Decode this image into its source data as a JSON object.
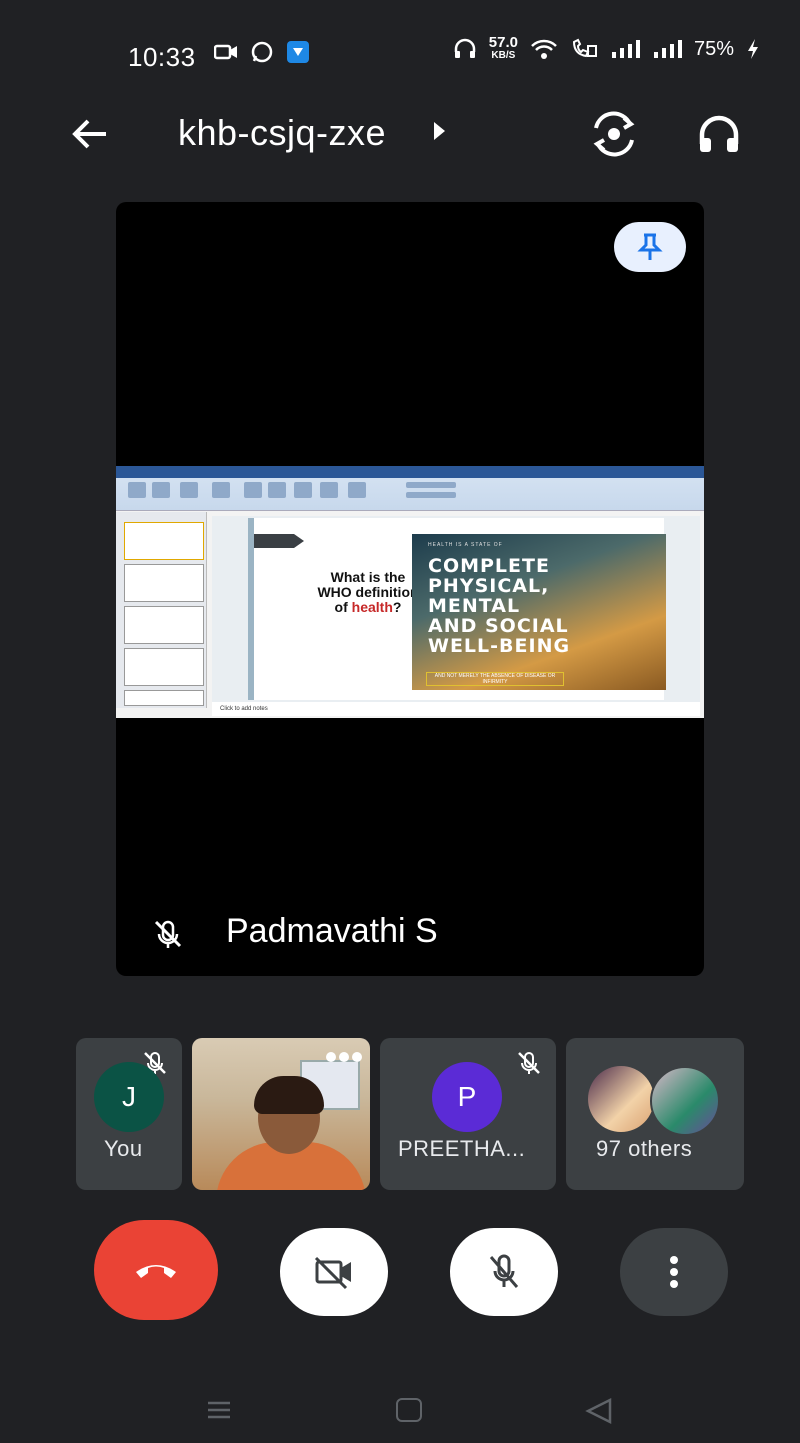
{
  "status_bar": {
    "time": "10:33",
    "speed_value": "57.0",
    "speed_unit": "KB/S",
    "battery": "75%"
  },
  "top_bar": {
    "meeting_code": "khb-csjq-zxe"
  },
  "main_tile": {
    "presenter": "Padmavathi S",
    "slide": {
      "question_1": "What is the",
      "question_2": "WHO definition",
      "question_3": "of ",
      "question_highlight": "health",
      "question_end": "?",
      "overline": "HEALTH IS A STATE OF",
      "big_1": "COMPLETE",
      "big_2": "PHYSICAL,",
      "big_3": "MENTAL",
      "big_4": "AND SOCIAL",
      "big_5": "WELL-BEING",
      "footer": "AND NOT MERELY THE ABSENCE OF DISEASE OR INFIRMITY",
      "notes_placeholder": "Click to add notes"
    }
  },
  "participants": [
    {
      "initial": "J",
      "name": "You",
      "avatar_color": "#0b5345",
      "muted": true
    },
    {
      "name": "",
      "video": true
    },
    {
      "initial": "P",
      "name": "PREETHA...",
      "avatar_color": "#5b2bd6",
      "muted": true
    },
    {
      "name": "97 others"
    }
  ],
  "colors": {
    "background": "#202124",
    "tile": "#3c4043",
    "end_call": "#ea4335",
    "pin_bg": "#e8f0fe",
    "pin_icon": "#1a73e8"
  }
}
